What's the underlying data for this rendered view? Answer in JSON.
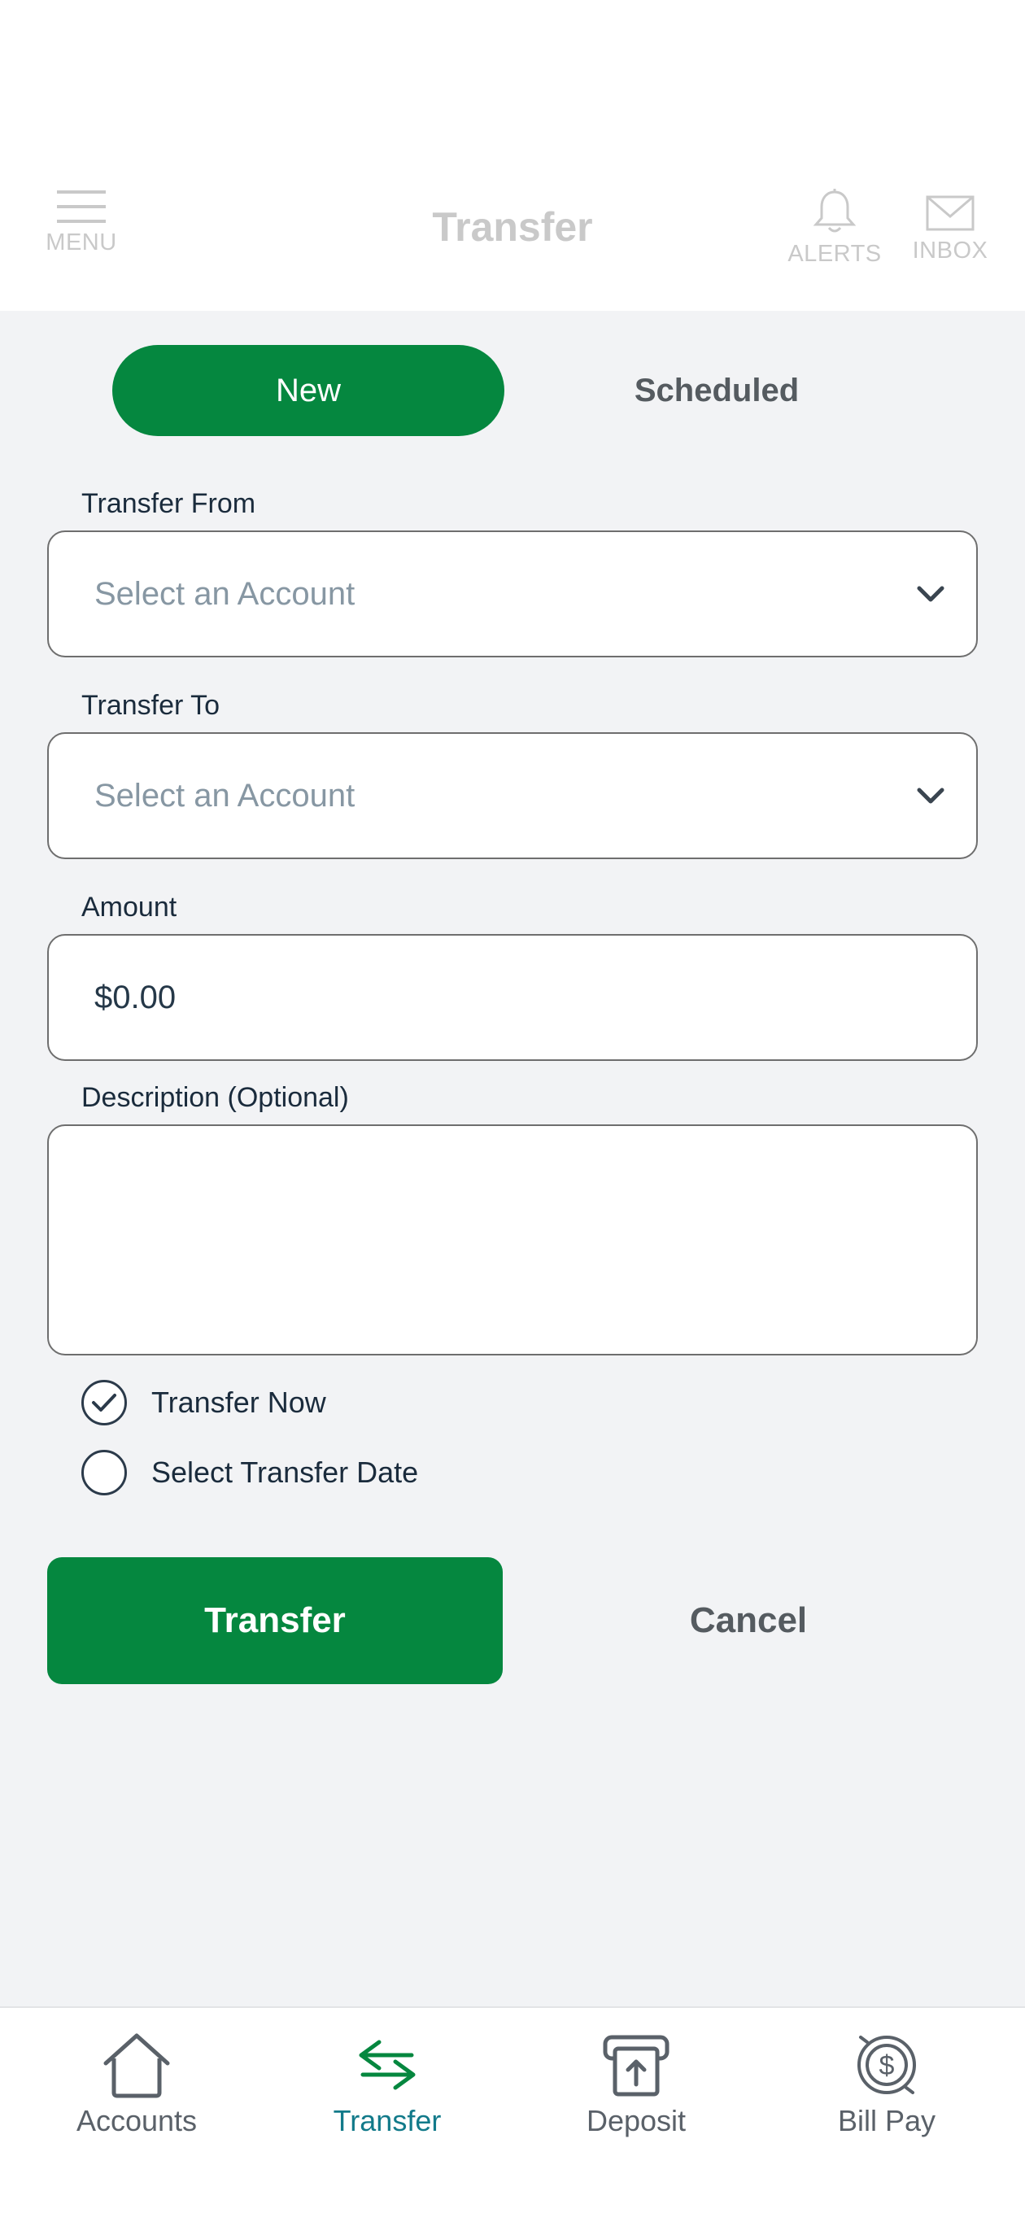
{
  "header": {
    "title": "Transfer",
    "menu_label": "MENU",
    "alerts_label": "ALERTS",
    "inbox_label": "INBOX"
  },
  "tabs": [
    {
      "label": "New",
      "active": true
    },
    {
      "label": "Scheduled",
      "active": false
    }
  ],
  "form": {
    "from_label": "Transfer From",
    "from_placeholder": "Select an Account",
    "to_label": "Transfer To",
    "to_placeholder": "Select an Account",
    "amount_label": "Amount",
    "amount_value": "$0.00",
    "description_label": "Description (Optional)",
    "description_value": "",
    "options": [
      {
        "label": "Transfer Now",
        "checked": true
      },
      {
        "label": "Select Transfer Date",
        "checked": false
      }
    ]
  },
  "actions": {
    "transfer_label": "Transfer",
    "cancel_label": "Cancel"
  },
  "bottom_nav": [
    {
      "label": "Accounts",
      "icon": "home-icon",
      "active": false
    },
    {
      "label": "Transfer",
      "icon": "transfer-arrows-icon",
      "active": true
    },
    {
      "label": "Deposit",
      "icon": "deposit-icon",
      "active": false
    },
    {
      "label": "Bill Pay",
      "icon": "bill-pay-icon",
      "active": false
    }
  ],
  "colors": {
    "brand_green": "#05873f",
    "active_nav": "#127a8a"
  }
}
